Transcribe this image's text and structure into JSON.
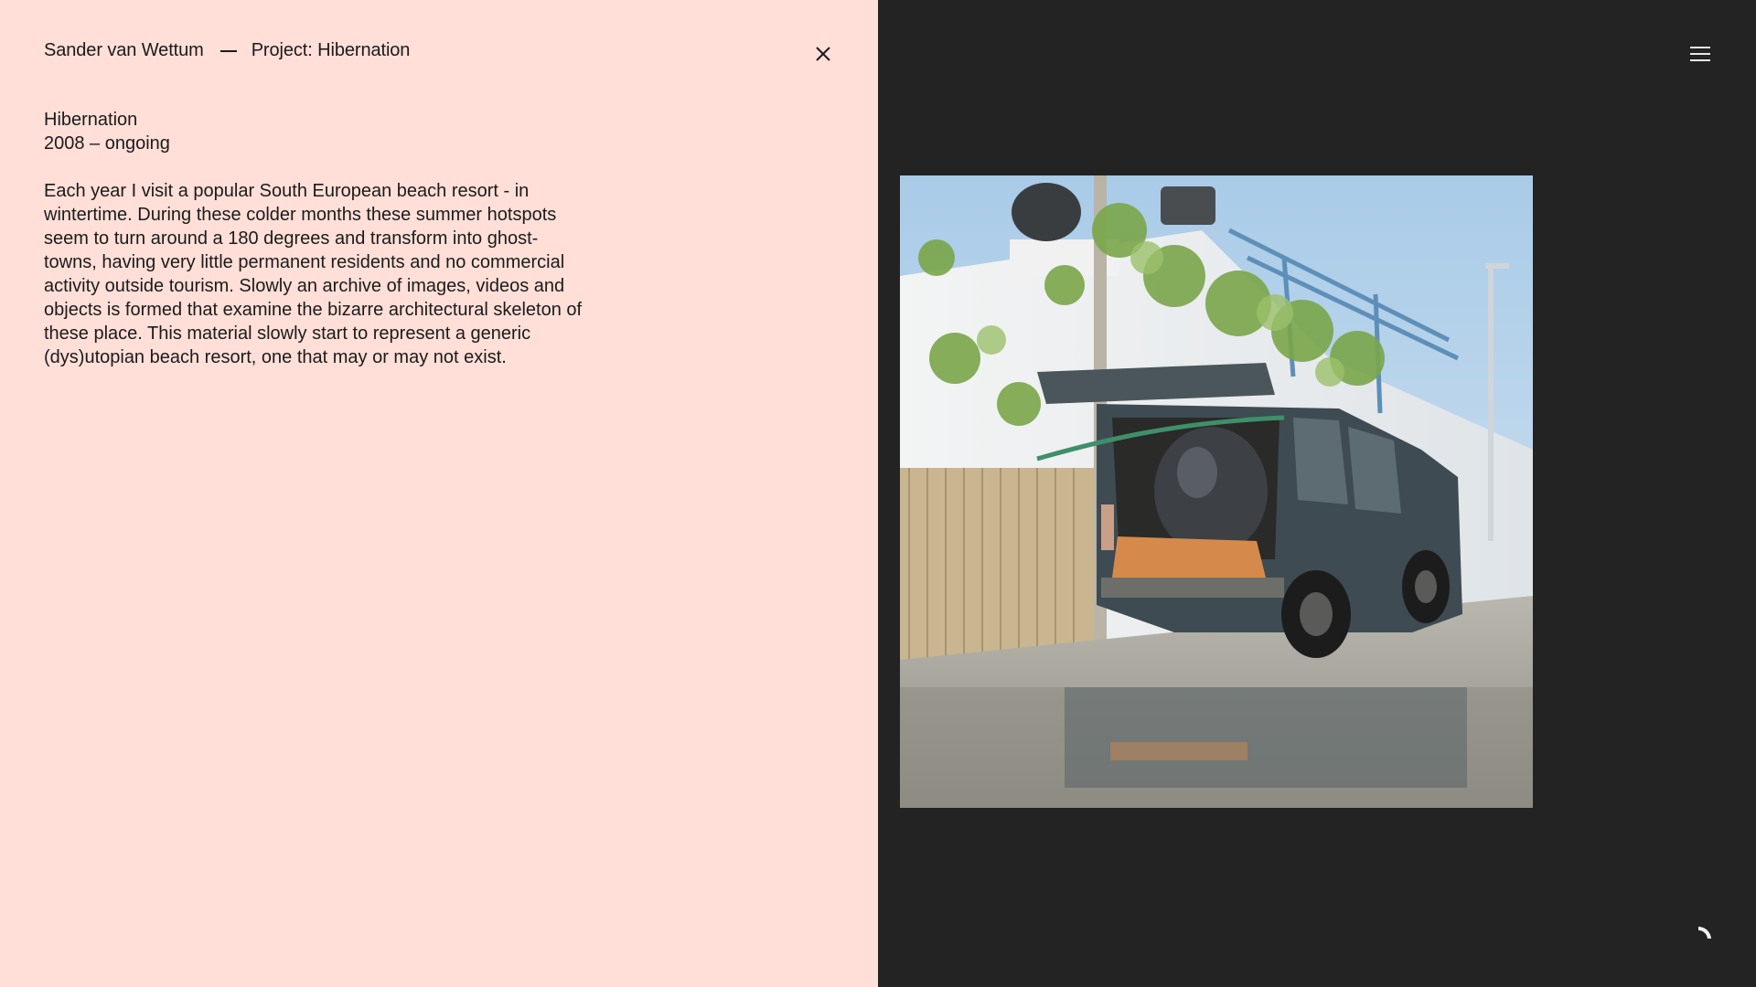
{
  "header": {
    "author": "Sander van Wettum",
    "separator": "—",
    "project_title": "Project: Hibernation",
    "close_icon": "close-icon"
  },
  "project": {
    "name": "Hibernation",
    "years": "2008 – ongoing",
    "description": "Each year I visit a popular South European beach resort - in wintertime. During these colder months these summer hotspots seem to turn around a 180 degrees and transform into ghost-towns, having very little permanent residents and no commercial activity outside tourism. Slowly an archive of images, videos and objects is formed that examine the bizarre architectural skeleton of these place. This material slowly start to represent a generic (dys)utopian beach resort, one that may or may not exist."
  },
  "gallery": {
    "menu_icon": "hamburger-menu-icon",
    "loader_icon": "loading-spinner-icon",
    "photo_subject": "van-with-tank-photo"
  },
  "colors": {
    "info_background": "#ffdfd8",
    "gallery_background": "#232323",
    "text": "#1b1b1b",
    "menu_icon": "#e8e8e8"
  }
}
